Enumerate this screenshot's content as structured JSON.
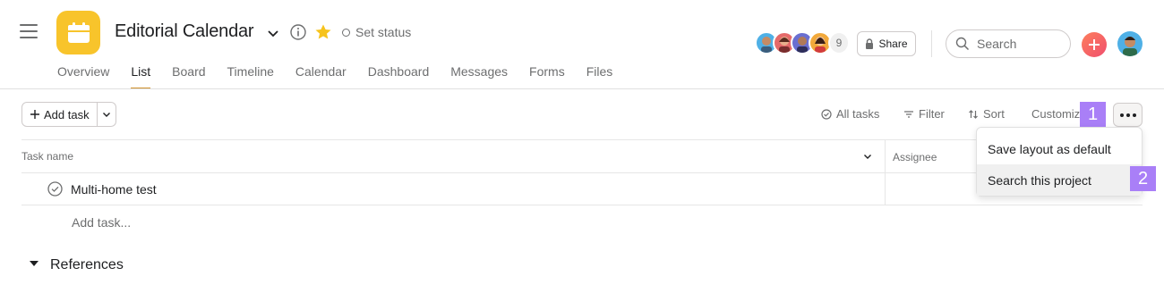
{
  "project": {
    "title": "Editorial Calendar",
    "icon": "calendar-icon",
    "icon_color": "#f8c42b",
    "set_status_label": "Set status"
  },
  "tabs": [
    {
      "label": "Overview",
      "active": false
    },
    {
      "label": "List",
      "active": true
    },
    {
      "label": "Board",
      "active": false
    },
    {
      "label": "Timeline",
      "active": false
    },
    {
      "label": "Calendar",
      "active": false
    },
    {
      "label": "Dashboard",
      "active": false
    },
    {
      "label": "Messages",
      "active": false
    },
    {
      "label": "Forms",
      "active": false
    },
    {
      "label": "Files",
      "active": false
    }
  ],
  "members": {
    "count": "9"
  },
  "topbar": {
    "share_label": "Share",
    "search_placeholder": "Search"
  },
  "toolbar": {
    "add_task_label": "Add task",
    "all_tasks_label": "All tasks",
    "filter_label": "Filter",
    "sort_label": "Sort",
    "customize_label": "Customize"
  },
  "table": {
    "columns": [
      "Task name",
      "Assignee"
    ],
    "rows": [
      {
        "name": "Multi-home test"
      }
    ],
    "add_task_inline": "Add task..."
  },
  "section": {
    "title": "References"
  },
  "menu": {
    "items": [
      {
        "label": "Save layout as default"
      },
      {
        "label": "Search this project"
      }
    ]
  },
  "annotations": {
    "badge1": "1",
    "badge2": "2",
    "badge_color": "#a97ff7"
  },
  "colors": {
    "accent_tab": "#d1922e",
    "add_button": "#f04f6e"
  }
}
